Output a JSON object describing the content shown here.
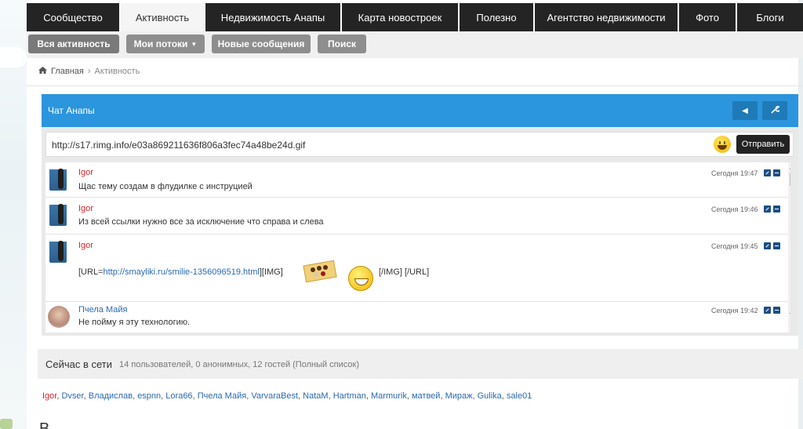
{
  "nav": {
    "tabs": [
      {
        "label": "Сообщество",
        "active": false
      },
      {
        "label": "Активность",
        "active": true
      },
      {
        "label": "Недвижимость Анапы",
        "active": false
      },
      {
        "label": "Карта новостроек",
        "active": false
      },
      {
        "label": "Полезно",
        "active": false
      },
      {
        "label": "Агентство недвижимости",
        "active": false
      },
      {
        "label": "Фото",
        "active": false
      },
      {
        "label": "Блоги",
        "active": false
      }
    ]
  },
  "subnav": {
    "all_activity": "Вся активность",
    "my_streams": "Мои потоки",
    "new_messages": "Новые сообщения",
    "search": "Поиск"
  },
  "breadcrumb": {
    "home": "Главная",
    "current": "Активность"
  },
  "chat": {
    "title": "Чат Анапы",
    "input_value": "http://s17.rimg.info/e03a869211636f806a3fec74a48be24d.gif",
    "send_label": "Отправить",
    "messages": [
      {
        "user": "Igor",
        "time": "Сегодня 19:47",
        "text": "Щас тему создам в флудилке с инструцией"
      },
      {
        "user": "Igor",
        "time": "Сегодня 19:46",
        "text": "Из всей ссылки нужно все за исключение что справа и слева"
      },
      {
        "user": "Igor",
        "time": "Сегодня 19:45",
        "text_prefix": "[URL=",
        "link": "http://smayliki.ru/smilie-1356096519.html",
        "text_mid": "][IMG]",
        "text_suffix": "[/IMG] [/URL]"
      },
      {
        "user": "Пчела Майя",
        "time": "Сегодня 19:42",
        "text": "Не пойму я эту технологию."
      }
    ]
  },
  "online": {
    "title": "Сейчас в сети",
    "info": "14 пользователей, 0 анонимных, 12 гостей (Полный список)",
    "users": [
      "Igor",
      "Dvser",
      "Владислав",
      "espnn",
      "Lora66",
      "Пчела Майя",
      "VarvaraBest",
      "NataM",
      "Hartman",
      "Marmurik",
      "матвей",
      "Мираж",
      "Gulika",
      "sale01"
    ]
  },
  "bottom": {
    "partial_heading": "В"
  },
  "colors": {
    "chat_header": "#2b95dd",
    "username_red": "#d8232a",
    "link_blue": "#2a68b0"
  }
}
